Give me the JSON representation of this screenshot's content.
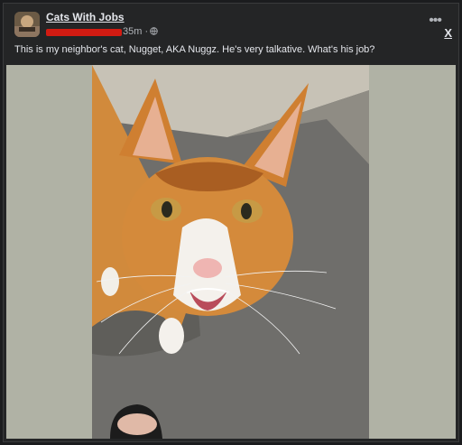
{
  "post": {
    "group_name": "Cats With Jobs",
    "time": "35m ·",
    "caption": "This is my neighbor's cat, Nugget, AKA Nuggz.  He's very talkative.  What's his job?",
    "close_label": "X",
    "more_label": "•••"
  },
  "icons": {
    "avatar": "group-avatar",
    "privacy": "globe-icon",
    "more": "more-options-icon"
  },
  "colors": {
    "background": "#242526",
    "media_background": "#b0b2a5",
    "redaction": "#d21b12"
  }
}
